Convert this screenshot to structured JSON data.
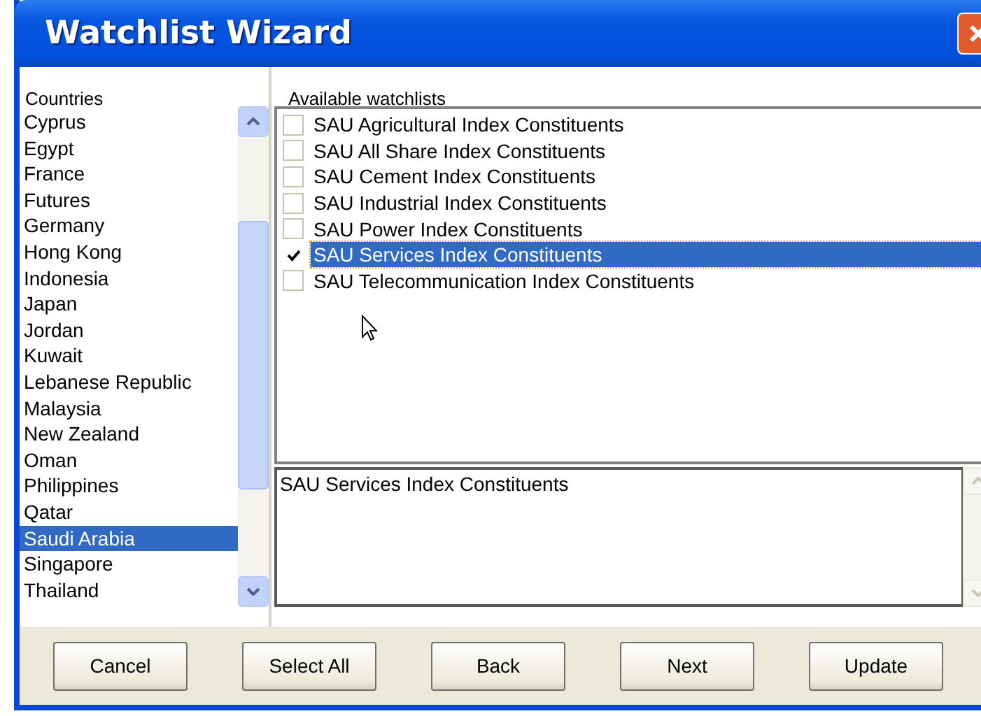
{
  "window": {
    "title": "Watchlist Wizard"
  },
  "countries": {
    "label": "Countries",
    "items": [
      {
        "name": "Cyprus",
        "selected": false
      },
      {
        "name": "Egypt",
        "selected": false
      },
      {
        "name": "France",
        "selected": false
      },
      {
        "name": "Futures",
        "selected": false
      },
      {
        "name": "Germany",
        "selected": false
      },
      {
        "name": "Hong Kong",
        "selected": false
      },
      {
        "name": "Indonesia",
        "selected": false
      },
      {
        "name": "Japan",
        "selected": false
      },
      {
        "name": "Jordan",
        "selected": false
      },
      {
        "name": "Kuwait",
        "selected": false
      },
      {
        "name": "Lebanese Republic",
        "selected": false
      },
      {
        "name": "Malaysia",
        "selected": false
      },
      {
        "name": "New Zealand",
        "selected": false
      },
      {
        "name": "Oman",
        "selected": false
      },
      {
        "name": "Philippines",
        "selected": false
      },
      {
        "name": "Qatar",
        "selected": false
      },
      {
        "name": "Saudi Arabia",
        "selected": true
      },
      {
        "name": "Singapore",
        "selected": false
      },
      {
        "name": "Thailand",
        "selected": false
      }
    ]
  },
  "watchlists": {
    "label": "Available watchlists",
    "items": [
      {
        "name": "SAU Agricultural Index Constituents",
        "checked": false,
        "selected": false
      },
      {
        "name": "SAU All Share Index Constituents",
        "checked": false,
        "selected": false
      },
      {
        "name": "SAU Cement Index Constituents",
        "checked": false,
        "selected": false
      },
      {
        "name": "SAU Industrial Index Constituents",
        "checked": false,
        "selected": false
      },
      {
        "name": "SAU Power Index Constituents",
        "checked": false,
        "selected": false
      },
      {
        "name": "SAU Services Index Constituents",
        "checked": true,
        "selected": true
      },
      {
        "name": "SAU Telecommunication Index Constituents",
        "checked": false,
        "selected": false
      }
    ]
  },
  "description": {
    "value": "SAU Services Index Constituents"
  },
  "buttons": [
    "Cancel",
    "Select All",
    "Back",
    "Next",
    "Update"
  ]
}
